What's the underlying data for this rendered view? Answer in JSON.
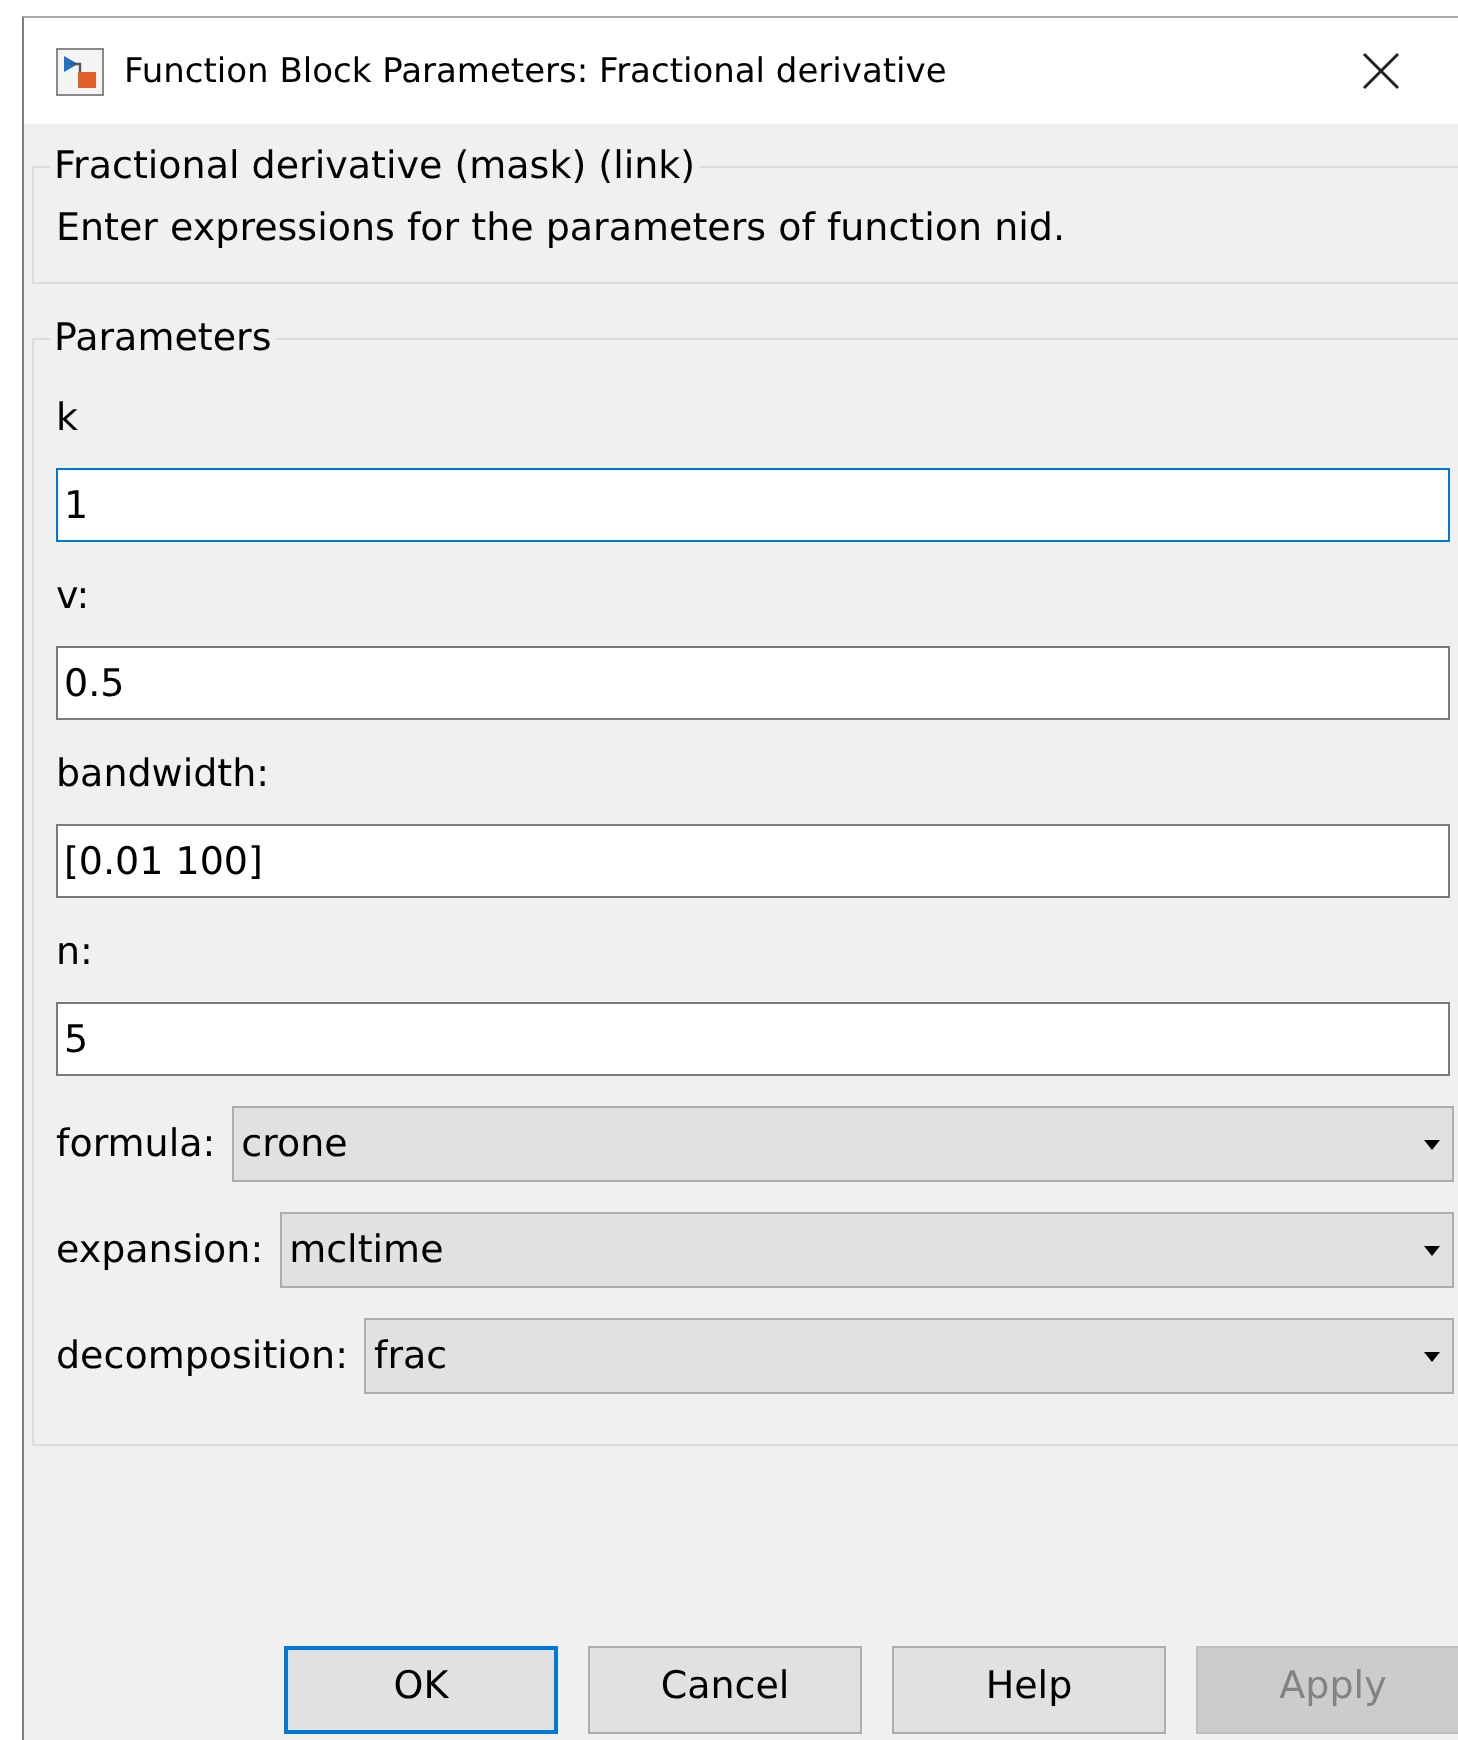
{
  "window": {
    "title": "Function Block Parameters: Fractional derivative"
  },
  "mask": {
    "title": "Fractional derivative (mask) (link)",
    "description": "Enter expressions for the parameters of function nid."
  },
  "parameters": {
    "title": "Parameters",
    "fields": [
      {
        "kind": "text",
        "label": "k",
        "value": "1",
        "focused": true
      },
      {
        "kind": "text",
        "label": "v:",
        "value": "0.5",
        "focused": false
      },
      {
        "kind": "text",
        "label": "bandwidth:",
        "value": "[0.01 100]",
        "focused": false
      },
      {
        "kind": "text",
        "label": "n:",
        "value": "5",
        "focused": false
      },
      {
        "kind": "select",
        "label": "formula:",
        "value": "crone"
      },
      {
        "kind": "select",
        "label": "expansion:",
        "value": "mcltime"
      },
      {
        "kind": "select",
        "label": "decomposition:",
        "value": "frac"
      }
    ]
  },
  "buttons": [
    {
      "label": "OK",
      "default": true,
      "disabled": false
    },
    {
      "label": "Cancel",
      "default": false,
      "disabled": false
    },
    {
      "label": "Help",
      "default": false,
      "disabled": false
    },
    {
      "label": "Apply",
      "default": false,
      "disabled": true
    }
  ]
}
